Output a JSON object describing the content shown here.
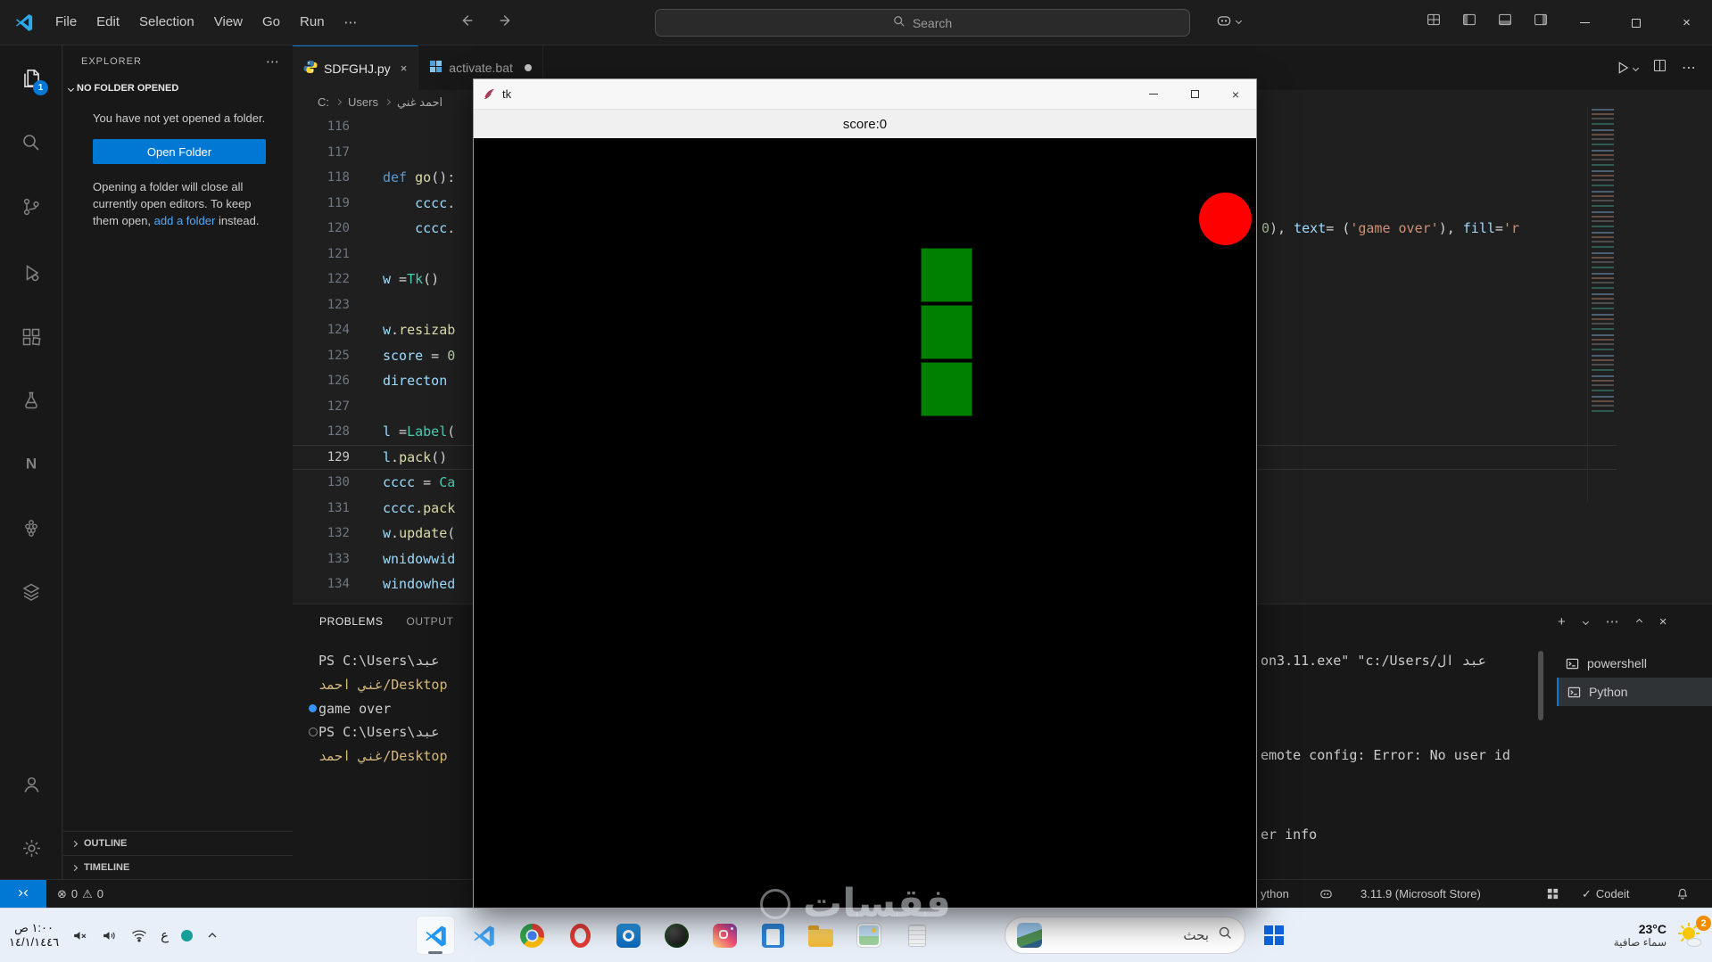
{
  "icons": {
    "more": "⋯",
    "close": "×",
    "plus": "+",
    "check": "✓",
    "error": "⊗",
    "warning": "⚠",
    "n": "N"
  },
  "titlebar": {
    "menus": [
      "File",
      "Edit",
      "Selection",
      "View",
      "Go",
      "Run"
    ],
    "search_placeholder": "Search"
  },
  "activity_badge": "1",
  "sidebar": {
    "title": "EXPLORER",
    "section_label": "NO FOLDER OPENED",
    "empty_text": "You have not yet opened a folder.",
    "open_button": "Open Folder",
    "hint_pre": "Opening a folder will close all currently open editors. To keep them open, ",
    "hint_link": "add a folder",
    "hint_post": " instead.",
    "outline_label": "OUTLINE",
    "timeline_label": "TIMELINE"
  },
  "tabs": [
    {
      "label": "SDFGHJ.py"
    },
    {
      "label": "activate.bat"
    }
  ],
  "breadcrumb": {
    "parts": [
      "C:",
      "Users",
      "احمد غني"
    ]
  },
  "editor": {
    "lines": [
      {
        "n": "116",
        "t": []
      },
      {
        "n": "117",
        "t": []
      },
      {
        "n": "118",
        "t": [
          [
            "def ",
            "kw"
          ],
          [
            "go",
            "fn"
          ],
          [
            "():",
            "pln"
          ]
        ]
      },
      {
        "n": "119",
        "t": [
          [
            "    ",
            "pln"
          ],
          [
            "cccc",
            "var"
          ],
          [
            ".",
            "pln"
          ]
        ]
      },
      {
        "n": "120",
        "t": [
          [
            "    ",
            "pln"
          ],
          [
            "cccc",
            "var"
          ],
          [
            ".",
            "pln"
          ]
        ]
      },
      {
        "n": "121",
        "t": []
      },
      {
        "n": "122",
        "t": [
          [
            "w",
            "var"
          ],
          [
            " =",
            "pln"
          ],
          [
            "Tk",
            "cls"
          ],
          [
            "()",
            "pln"
          ]
        ]
      },
      {
        "n": "123",
        "t": []
      },
      {
        "n": "124",
        "t": [
          [
            "w",
            "var"
          ],
          [
            ".",
            "pln"
          ],
          [
            "resizab",
            "fn"
          ]
        ]
      },
      {
        "n": "125",
        "t": [
          [
            "score",
            "var"
          ],
          [
            " = ",
            "pln"
          ],
          [
            "0",
            "num"
          ]
        ]
      },
      {
        "n": "126",
        "t": [
          [
            "directon",
            "var"
          ]
        ]
      },
      {
        "n": "127",
        "t": []
      },
      {
        "n": "128",
        "t": [
          [
            "l",
            "var"
          ],
          [
            " =",
            "pln"
          ],
          [
            "Label",
            "cls"
          ],
          [
            "(",
            "pln"
          ]
        ]
      },
      {
        "n": "129",
        "a": 1,
        "t": [
          [
            "l",
            "var"
          ],
          [
            ".",
            "pln"
          ],
          [
            "pack",
            "fn"
          ],
          [
            "()",
            "pln"
          ]
        ]
      },
      {
        "n": "130",
        "t": [
          [
            "cccc",
            "var"
          ],
          [
            " = ",
            "pln"
          ],
          [
            "Ca",
            "cls"
          ]
        ]
      },
      {
        "n": "131",
        "t": [
          [
            "cccc",
            "var"
          ],
          [
            ".",
            "pln"
          ],
          [
            "pack",
            "fn"
          ]
        ]
      },
      {
        "n": "132",
        "t": [
          [
            "w",
            "var"
          ],
          [
            ".",
            "pln"
          ],
          [
            "update",
            "fn"
          ],
          [
            "(",
            "pln"
          ]
        ]
      },
      {
        "n": "133",
        "t": [
          [
            "wnidowwid",
            "var"
          ]
        ]
      },
      {
        "n": "134",
        "t": [
          [
            "windowhed",
            "var"
          ]
        ]
      }
    ],
    "fragment": [
      [
        "0",
        "num"
      ],
      [
        "), ",
        "pln"
      ],
      [
        "text",
        "var"
      ],
      [
        "= ",
        "pln"
      ],
      [
        "(",
        "pln"
      ],
      [
        "'game over'",
        "str"
      ],
      [
        "), ",
        "pln"
      ],
      [
        "fill",
        "var"
      ],
      [
        "=",
        "pln"
      ],
      [
        "'r",
        "str"
      ]
    ]
  },
  "panel": {
    "tabs": [
      "PROBLEMS",
      "OUTPUT"
    ],
    "terminal_rows": [
      {
        "deco": "",
        "parts": [
          [
            "PS C:\\Users\\عبد",
            "pln"
          ]
        ]
      },
      {
        "deco": "",
        "parts": [
          [
            "غني احمد/Desktop",
            "path"
          ]
        ]
      },
      {
        "deco": "dot",
        "parts": [
          [
            "game over",
            "pln"
          ]
        ]
      },
      {
        "deco": "ring",
        "parts": [
          [
            "PS C:\\Users\\عبد",
            "pln"
          ]
        ]
      },
      {
        "deco": "",
        "parts": [
          [
            "غني احمد/Desktop",
            "path"
          ]
        ]
      }
    ],
    "fragments": [
      {
        "text": "on3.11.exe\" \"c:/Users/عبد ال"
      },
      {
        "text": "emote config: Error: No user id"
      },
      {
        "text": "er info"
      }
    ],
    "terminals": [
      {
        "label": "powershell"
      },
      {
        "label": "Python"
      }
    ]
  },
  "status": {
    "errors": "0",
    "warnings": "0",
    "python_partial": "ython",
    "interpreter": "3.11.9 (Microsoft Store)",
    "codeit": "Codeit"
  },
  "tk": {
    "title": "tk",
    "score": "score:0"
  },
  "taskbar": {
    "time": "١:٠٠ ص",
    "date": "١٤/١/١٤٤٦",
    "lang": "ع",
    "search_label": "بحث",
    "weather_temp": "23°C",
    "weather_desc": "سماء صافية",
    "weather_badge": "2"
  },
  "watermark": "فقسات"
}
